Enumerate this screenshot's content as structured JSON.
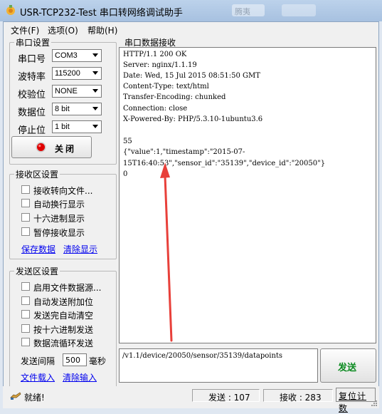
{
  "window": {
    "title": "USR-TCP232-Test 串口转网络调试助手",
    "blurred_text": "腾夷"
  },
  "menu": [
    {
      "label": "文件(F)"
    },
    {
      "label": "选项(O)"
    },
    {
      "label": "帮助(H)"
    }
  ],
  "serial": {
    "legend": "串口设置",
    "rows": [
      {
        "label": "串口号",
        "value": "COM3"
      },
      {
        "label": "波特率",
        "value": "115200"
      },
      {
        "label": "校验位",
        "value": "NONE"
      },
      {
        "label": "数据位",
        "value": "8 bit"
      },
      {
        "label": "停止位",
        "value": "1 bit"
      }
    ],
    "close_button": "关闭"
  },
  "receive_settings": {
    "legend": "接收区设置",
    "options": [
      {
        "label": "接收转向文件...",
        "checked": false
      },
      {
        "label": "自动换行显示",
        "checked": false
      },
      {
        "label": "十六进制显示",
        "checked": false
      },
      {
        "label": "暂停接收显示",
        "checked": false
      }
    ],
    "save_link": "保存数据",
    "clear_link": "清除显示"
  },
  "send_settings": {
    "legend": "发送区设置",
    "options": [
      {
        "label": "启用文件数据源...",
        "checked": false
      },
      {
        "label": "自动发送附加位",
        "checked": false
      },
      {
        "label": "发送完自动清空",
        "checked": false
      },
      {
        "label": "按十六进制发送",
        "checked": false
      },
      {
        "label": "数据流循环发送",
        "checked": false
      }
    ],
    "interval_label": "发送间隔",
    "interval_value": "500",
    "interval_unit": "毫秒",
    "load_link": "文件载入",
    "clear_link": "清除输入"
  },
  "receive": {
    "legend": "串口数据接收",
    "lines": [
      "HTTP/1.1 200 OK",
      "Server: nginx/1.1.19",
      "Date: Wed, 15 Jul 2015 08:51:50 GMT",
      "Content-Type: text/html",
      "Transfer-Encoding: chunked",
      "Connection: close",
      "X-Powered-By: PHP/5.3.10-1ubuntu3.6",
      "",
      "55",
      "{\"value\":1,\"timestamp\":\"2015-07-",
      "15T16:40:53\",\"sensor_id\":\"35139\",\"device_id\":\"20050\"}",
      "0"
    ]
  },
  "send": {
    "input_value": "/v1.1/device/20050/sensor/35139/datapoints",
    "button": "发送"
  },
  "status": {
    "ready": "就绪!",
    "sent": "发送 : 107",
    "received": "接收 : 283",
    "reset": "复位计数"
  },
  "colors": {
    "close_dot": "#e00000",
    "send_label": "#0a8a1f",
    "link": "#0000ee",
    "annotation_arrow": "#e8403a"
  }
}
